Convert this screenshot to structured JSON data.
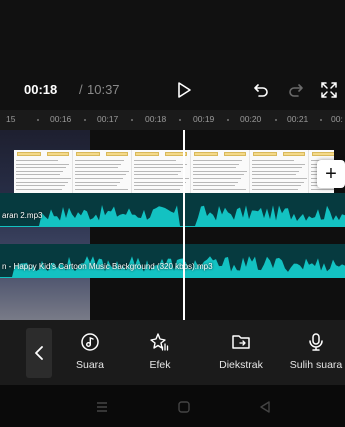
{
  "player": {
    "time_current": "00:18",
    "time_separator": "/",
    "time_total": "10:37"
  },
  "ruler": {
    "ticks": [
      "15",
      "00:16",
      "00:17",
      "00:18",
      "00:19",
      "00:20",
      "00:21",
      "00:"
    ]
  },
  "timeline": {
    "audio_tracks": [
      {
        "label": "aran 2.mp3"
      },
      {
        "label": "n - Happy Kid's Cartoon Music Background (320 kbps).mp3"
      }
    ]
  },
  "toolbar": {
    "tools": [
      {
        "label": "Suara",
        "icon": "music-note-icon"
      },
      {
        "label": "Efek",
        "icon": "sparkle-effect-icon"
      },
      {
        "label": "Diekstrak",
        "icon": "extract-folder-icon"
      },
      {
        "label": "Sulih suara",
        "icon": "microphone-icon"
      }
    ]
  },
  "colors": {
    "audio_track_bg": "#063a3f",
    "waveform": "#13c2c2",
    "toolbar_bg": "#1b1b1b"
  }
}
